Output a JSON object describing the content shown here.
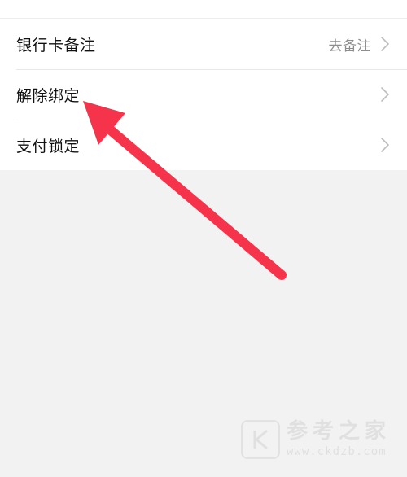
{
  "settings_list": {
    "items": [
      {
        "label": "银行卡备注",
        "hint": "去备注",
        "icon": "chevron-right-icon"
      },
      {
        "label": "解除绑定",
        "hint": "",
        "icon": "chevron-right-icon"
      },
      {
        "label": "支付锁定",
        "hint": "",
        "icon": "chevron-right-icon"
      }
    ]
  },
  "annotation": {
    "type": "red-arrow",
    "color": "#f5334b",
    "points_to": "解除绑定"
  },
  "watermark": {
    "logo_icon": "k-logo-icon",
    "title": "参考之家",
    "url": "www.ckdzb.com"
  },
  "colors": {
    "background": "#f2f2f2",
    "card": "#ffffff",
    "label": "#111111",
    "hint": "#8d8d8d",
    "chevron": "#bdbdbd",
    "divider": "#e7e7e7"
  }
}
